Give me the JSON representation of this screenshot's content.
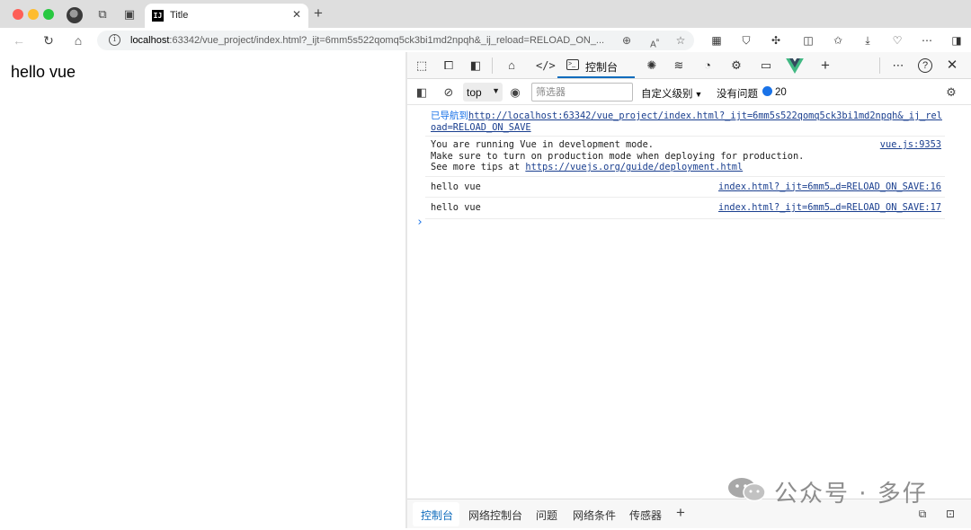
{
  "browser": {
    "tab": {
      "favicon": "IJ",
      "title": "Title",
      "close": "✕"
    },
    "new_tab": "+",
    "url_host": "localhost",
    "url_rest": ":63342/vue_project/index.html?_ijt=6mm5s522qomq5ck3bi1md2npqh&_ij_reload=RELOAD_ON_..."
  },
  "page": {
    "text": "hello vue"
  },
  "devtools": {
    "active_tab": "控制台",
    "context": "top",
    "filter_placeholder": "筛选器",
    "levels_label": "自定义级别",
    "issues_label": "没有问题",
    "message_count": "20",
    "console": {
      "nav_prefix": "已导航到",
      "nav_url_line1": "http://localhost:63342/vue_project/index.html?_ijt=6mm5s522qomq5ck3bi1md2npqh&_ij_rel",
      "nav_url_line2": "oad=RELOAD_ON_SAVE",
      "vue_msg_line1": "You are running Vue in development mode.",
      "vue_msg_line2": "Make sure to turn on production mode when deploying for production.",
      "vue_msg_line3_prefix": "See more tips at ",
      "vue_msg_link": "https://vuejs.org/guide/deployment.html",
      "vue_msg_source": "vue.js:9353",
      "log1_text": "hello vue",
      "log1_source": "index.html?_ijt=6mm5…d=RELOAD_ON_SAVE:16",
      "log2_text": "hello vue",
      "log2_source": "index.html?_ijt=6mm5…d=RELOAD_ON_SAVE:17",
      "prompt": "›"
    },
    "drawer_tabs": [
      "控制台",
      "网络控制台",
      "问题",
      "网络条件",
      "传感器"
    ],
    "drawer_plus": "+"
  },
  "watermark": {
    "text": "公众号 · 多仔"
  },
  "colors": {
    "accent": "#0f6cbd",
    "vue_green": "#41b883",
    "vue_dark": "#35495e"
  }
}
